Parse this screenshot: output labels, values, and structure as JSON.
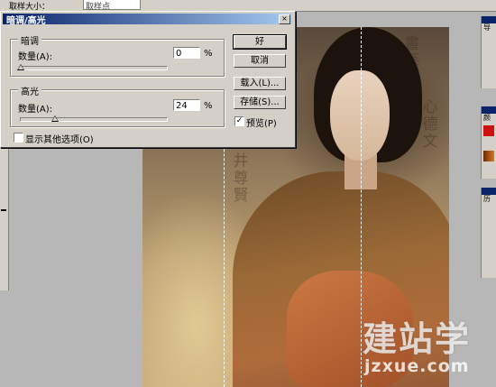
{
  "appbar": {
    "label": "取样大小：",
    "field": "取样点"
  },
  "dialog": {
    "title": "暗调/高光",
    "close_glyph": "×",
    "shadows": {
      "group_title": "暗调",
      "amount_label": "数量(A):",
      "amount_value": "0",
      "unit": "%",
      "slider_fraction": 0
    },
    "highlights": {
      "group_title": "高光",
      "amount_label": "数量(A):",
      "amount_value": "24",
      "unit": "%",
      "slider_fraction": 0.24
    },
    "more_options_label": "显示其他选项(O)",
    "more_options_checked": false,
    "buttons": {
      "ok": "好",
      "cancel": "取消",
      "load": "载入(L)...",
      "save": "存储(S)..."
    },
    "preview_label": "预览(P)",
    "preview_checked": true,
    "check_glyph": "✓"
  },
  "right_panels": {
    "tab1": "导",
    "tab2": "颜",
    "tab3": "历",
    "swatch_colors": [
      "#cc1111",
      "#d87a1e"
    ]
  },
  "watermark": {
    "big": "建站学",
    "small": "jzxue.com"
  },
  "colors": {
    "titlebar": "#0a246a",
    "dialog_bg": "#d4d0c8"
  }
}
